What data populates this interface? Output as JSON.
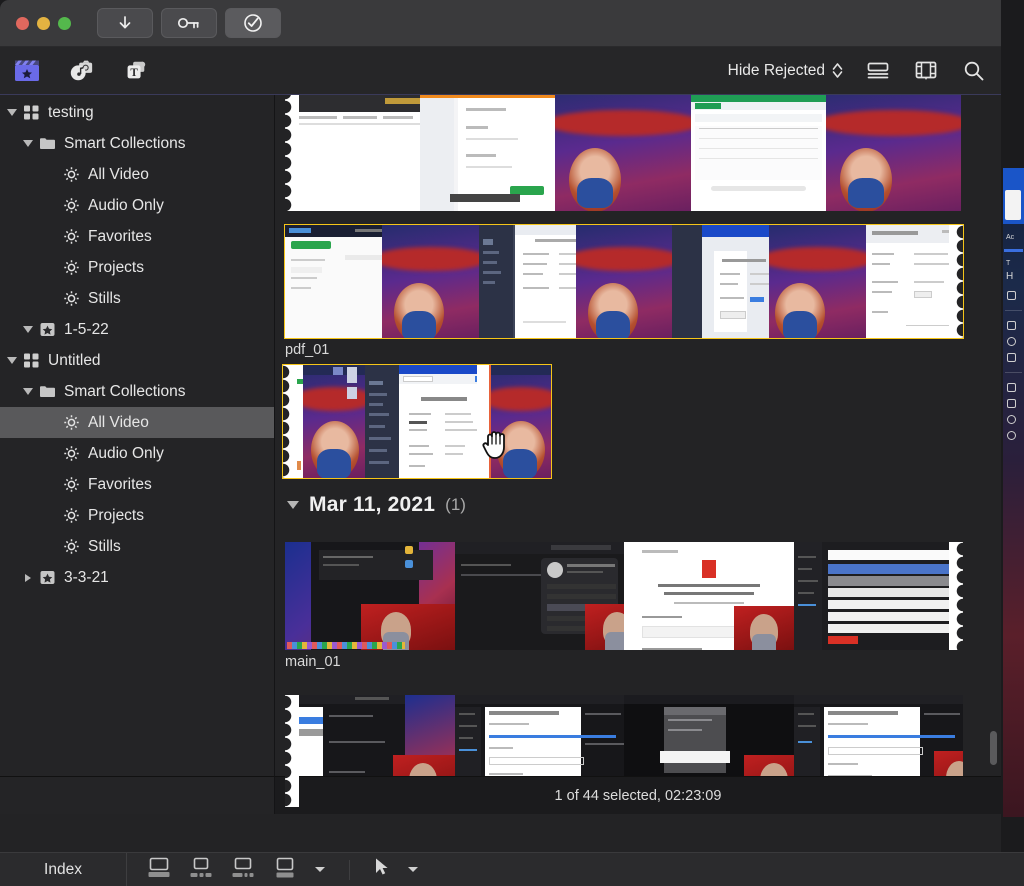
{
  "window": {
    "traffic_lights": [
      "close",
      "minimize",
      "zoom"
    ],
    "titlebar_buttons": [
      {
        "name": "download-button",
        "icon": "download-arrow-icon"
      },
      {
        "name": "keychain-button",
        "icon": "key-icon"
      },
      {
        "name": "verify-button",
        "icon": "check-circle-icon"
      }
    ]
  },
  "toolbar": {
    "left_icons": [
      {
        "name": "libraries-button",
        "icon": "clapperboard-star-icon",
        "active": true
      },
      {
        "name": "photos-audio-button",
        "icon": "photos-audio-icon",
        "active": false
      },
      {
        "name": "titles-generators-button",
        "icon": "titles-text-icon",
        "active": false
      }
    ],
    "filter_label": "Hide Rejected",
    "right_icons": [
      {
        "name": "list-view-button",
        "icon": "list-view-icon"
      },
      {
        "name": "filmstrip-view-button",
        "icon": "filmstrip-icon"
      },
      {
        "name": "search-button",
        "icon": "search-icon"
      }
    ]
  },
  "sidebar": {
    "items": [
      {
        "label": "testing",
        "depth": 0,
        "icon": "library-grid-icon",
        "disclosure": "open",
        "selected": false
      },
      {
        "label": "Smart Collections",
        "depth": 1,
        "icon": "folder-icon",
        "disclosure": "open",
        "selected": false
      },
      {
        "label": "All Video",
        "depth": 2,
        "icon": "gear-star-icon",
        "disclosure": "none",
        "selected": false
      },
      {
        "label": "Audio Only",
        "depth": 2,
        "icon": "gear-star-icon",
        "disclosure": "none",
        "selected": false
      },
      {
        "label": "Favorites",
        "depth": 2,
        "icon": "gear-star-icon",
        "disclosure": "none",
        "selected": false
      },
      {
        "label": "Projects",
        "depth": 2,
        "icon": "gear-star-icon",
        "disclosure": "none",
        "selected": false
      },
      {
        "label": "Stills",
        "depth": 2,
        "icon": "gear-star-icon",
        "disclosure": "none",
        "selected": false
      },
      {
        "label": "1-5-22",
        "depth": 1,
        "icon": "event-star-icon",
        "disclosure": "open",
        "selected": false
      },
      {
        "label": "Untitled",
        "depth": 0,
        "icon": "library-grid-icon",
        "disclosure": "open",
        "selected": false
      },
      {
        "label": "Smart Collections",
        "depth": 1,
        "icon": "folder-icon",
        "disclosure": "open",
        "selected": false
      },
      {
        "label": "All Video",
        "depth": 2,
        "icon": "gear-star-icon",
        "disclosure": "none",
        "selected": true
      },
      {
        "label": "Audio Only",
        "depth": 2,
        "icon": "gear-star-icon",
        "disclosure": "none",
        "selected": false
      },
      {
        "label": "Favorites",
        "depth": 2,
        "icon": "gear-star-icon",
        "disclosure": "none",
        "selected": false
      },
      {
        "label": "Projects",
        "depth": 2,
        "icon": "gear-star-icon",
        "disclosure": "none",
        "selected": false
      },
      {
        "label": "Stills",
        "depth": 2,
        "icon": "gear-star-icon",
        "disclosure": "none",
        "selected": false
      },
      {
        "label": "3-3-21",
        "depth": 1,
        "icon": "event-star-icon",
        "disclosure": "closed",
        "selected": false
      }
    ]
  },
  "browser": {
    "clips": [
      {
        "name": "clip-row-1",
        "label": "",
        "selected": false
      },
      {
        "name": "clip-row-2",
        "label": "pdf_01",
        "selected": true
      },
      {
        "name": "clip-row-3",
        "label": "",
        "selected": true
      },
      {
        "name": "clip-row-4",
        "label": "main_01",
        "selected": false
      },
      {
        "name": "clip-row-5",
        "label": "",
        "selected": false
      }
    ],
    "date_section": {
      "label": "Mar 11, 2021",
      "count": "(1)",
      "expanded": true
    },
    "cursor": "open-hand-cursor"
  },
  "status": {
    "text": "1 of 44 selected, 02:23:09"
  },
  "bottom_bar": {
    "index_label": "Index",
    "tools": [
      {
        "name": "timeline-tool-1",
        "icon": "window-bottom-icon"
      },
      {
        "name": "timeline-tool-2",
        "icon": "window-split-icon"
      },
      {
        "name": "timeline-tool-3",
        "icon": "window-split-alt-icon"
      },
      {
        "name": "timeline-tool-4",
        "icon": "window-full-icon"
      },
      {
        "name": "timeline-tool-menu",
        "icon": "chevron-down-icon"
      },
      {
        "name": "select-tool",
        "icon": "arrow-pointer-icon"
      },
      {
        "name": "select-tool-menu",
        "icon": "chevron-down-icon"
      }
    ]
  },
  "colors": {
    "selection_yellow": "#f5c518",
    "titlebar": "#3a3a3c",
    "panel": "#242426",
    "sidebar_selection": "#59595b",
    "accent_purple": "#5c5ce0"
  }
}
